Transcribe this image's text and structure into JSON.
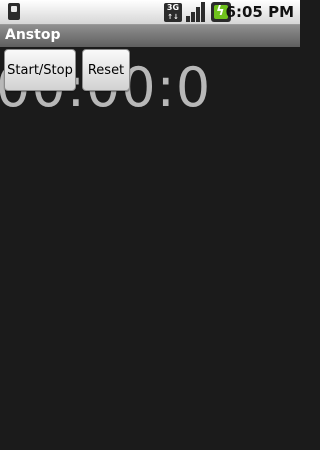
{
  "status_bar": {
    "time": "6:05 PM",
    "network_label": "3G",
    "network_arrows": "↑↓",
    "icons": [
      "sd-card-icon",
      "network-3g-icon",
      "signal-strength-icon",
      "battery-charging-icon"
    ]
  },
  "app": {
    "title": "Anstop"
  },
  "stopwatch": {
    "display": "00:00:0",
    "buttons": {
      "start_stop_label": "Start/Stop",
      "reset_label": "Reset"
    }
  },
  "colors": {
    "background": "#1b1b1b",
    "title_bar": "#7a7a7a",
    "clock_text": "#b8b8b8",
    "battery_fill": "#6fc21c"
  }
}
